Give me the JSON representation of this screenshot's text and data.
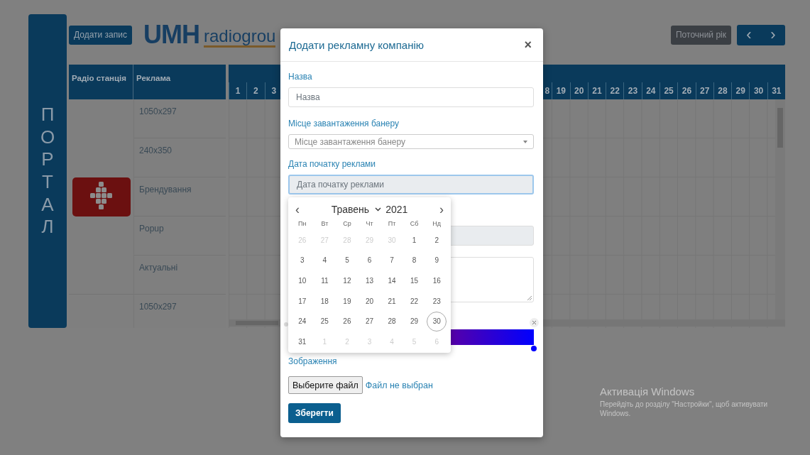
{
  "sidebar": {
    "title": "ПОРТАЛ"
  },
  "toolbar": {
    "add_button": "Додати запис",
    "logo": {
      "brand": "UMH",
      "suffix": "radiogrou"
    },
    "current_year_button": "Поточний рік",
    "prev": "‹",
    "next": "›"
  },
  "table": {
    "columns": [
      "Радіо станція",
      "Реклама"
    ],
    "day_headers": {
      "start": [
        "1",
        "2",
        "3"
      ],
      "end": [
        "8",
        "19",
        "20",
        "21",
        "22",
        "23",
        "24",
        "25",
        "26",
        "27",
        "28",
        "29",
        "30",
        "31"
      ]
    },
    "stations": [
      {
        "kind": "logo",
        "ads": [
          "1050x297",
          "240x350",
          "Брендування",
          "Popup",
          "Актуальні"
        ]
      },
      {
        "kind": "blank",
        "ads": [
          "1050x297"
        ]
      }
    ]
  },
  "modal": {
    "title": "Додати рекламну компанію",
    "close": "×",
    "fields": [
      {
        "kind": "text",
        "label": "Назва",
        "placeholder": "Назва"
      },
      {
        "kind": "select",
        "label": "Місце завантаження банеру",
        "placeholder": "Місце завантаження банеру"
      },
      {
        "kind": "date",
        "label": "Дата початку реклами",
        "placeholder": "Дата початку реклами",
        "focused": true
      }
    ],
    "image_label": "Зображення",
    "file_button": "Выберите файл",
    "file_status": "Файл не выбран",
    "save_button": "Зберегти"
  },
  "datepicker": {
    "month": "Травень",
    "year": "2021",
    "prev": "‹",
    "next": "›",
    "weekdays": [
      "Пн",
      "Вт",
      "Ср",
      "Чт",
      "Пт",
      "Сб",
      "Нд"
    ],
    "weeks": [
      [
        {
          "day": "26",
          "outside": true,
          "selected": false
        },
        {
          "day": "27",
          "outside": true,
          "selected": false
        },
        {
          "day": "28",
          "outside": true,
          "selected": false
        },
        {
          "day": "29",
          "outside": true,
          "selected": false
        },
        {
          "day": "30",
          "outside": true,
          "selected": false
        },
        {
          "day": "1",
          "outside": false,
          "selected": false
        },
        {
          "day": "2",
          "outside": false,
          "selected": false
        }
      ],
      [
        {
          "day": "3",
          "outside": false,
          "selected": false
        },
        {
          "day": "4",
          "outside": false,
          "selected": false
        },
        {
          "day": "5",
          "outside": false,
          "selected": false
        },
        {
          "day": "6",
          "outside": false,
          "selected": false
        },
        {
          "day": "7",
          "outside": false,
          "selected": false
        },
        {
          "day": "8",
          "outside": false,
          "selected": false
        },
        {
          "day": "9",
          "outside": false,
          "selected": false
        }
      ],
      [
        {
          "day": "10",
          "outside": false,
          "selected": false
        },
        {
          "day": "11",
          "outside": false,
          "selected": false
        },
        {
          "day": "12",
          "outside": false,
          "selected": false
        },
        {
          "day": "13",
          "outside": false,
          "selected": false
        },
        {
          "day": "14",
          "outside": false,
          "selected": false
        },
        {
          "day": "15",
          "outside": false,
          "selected": false
        },
        {
          "day": "16",
          "outside": false,
          "selected": false
        }
      ],
      [
        {
          "day": "17",
          "outside": false,
          "selected": false
        },
        {
          "day": "18",
          "outside": false,
          "selected": false
        },
        {
          "day": "19",
          "outside": false,
          "selected": false
        },
        {
          "day": "20",
          "outside": false,
          "selected": false
        },
        {
          "day": "21",
          "outside": false,
          "selected": false
        },
        {
          "day": "22",
          "outside": false,
          "selected": false
        },
        {
          "day": "23",
          "outside": false,
          "selected": false
        }
      ],
      [
        {
          "day": "24",
          "outside": false,
          "selected": false
        },
        {
          "day": "25",
          "outside": false,
          "selected": false
        },
        {
          "day": "26",
          "outside": false,
          "selected": false
        },
        {
          "day": "27",
          "outside": false,
          "selected": false
        },
        {
          "day": "28",
          "outside": false,
          "selected": false
        },
        {
          "day": "29",
          "outside": false,
          "selected": false
        },
        {
          "day": "30",
          "outside": false,
          "selected": true
        }
      ],
      [
        {
          "day": "31",
          "outside": false,
          "selected": false
        },
        {
          "day": "1",
          "outside": true,
          "selected": false
        },
        {
          "day": "2",
          "outside": true,
          "selected": false
        },
        {
          "day": "3",
          "outside": true,
          "selected": false
        },
        {
          "day": "4",
          "outside": true,
          "selected": false
        },
        {
          "day": "5",
          "outside": true,
          "selected": false
        },
        {
          "day": "6",
          "outside": true,
          "selected": false
        }
      ]
    ]
  },
  "activation_notice": {
    "title": "Активація Windows",
    "text": "Перейдіть до розділу \"Настройки\", щоб активувати Windows."
  }
}
